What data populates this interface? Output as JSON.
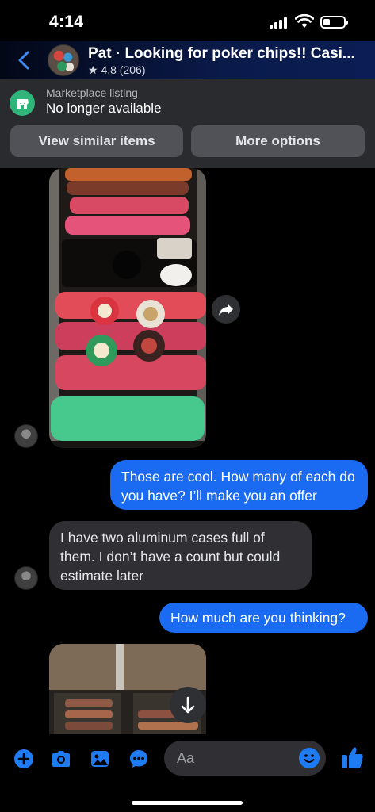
{
  "status_bar": {
    "time": "4:14",
    "battery_level": 0.35
  },
  "header": {
    "title": "Pat · Looking for poker chips!! Casi...",
    "rating": "★ 4.8 (206)",
    "accent": "#1b6bf2"
  },
  "listing": {
    "label": "Marketplace listing",
    "status": "No longer available",
    "view_similar_label": "View similar items",
    "more_options_label": "More options"
  },
  "messages": [
    {
      "from": "them",
      "type": "image",
      "description": "poker chip case"
    },
    {
      "from": "me",
      "type": "text",
      "text": "Those are cool.  How many of each do you have? I’ll make you an offer"
    },
    {
      "from": "them",
      "type": "text",
      "text": "I have two aluminum cases full of them. I don’t have a count but could estimate later"
    },
    {
      "from": "me",
      "type": "text",
      "text": "How much are you thinking?"
    },
    {
      "from": "them",
      "type": "image",
      "description": "aluminum case with chips"
    }
  ],
  "composer": {
    "placeholder": "Aa",
    "icons": [
      "plus-icon",
      "camera-icon",
      "gallery-icon",
      "chat-bubble-icon",
      "emoji-icon",
      "thumbs-up-icon"
    ]
  },
  "colors": {
    "bubble_out": "#1b6bf2",
    "bubble_in": "#303034",
    "listing_bg": "#2a2b2e",
    "store_green": "#2fb57a"
  }
}
